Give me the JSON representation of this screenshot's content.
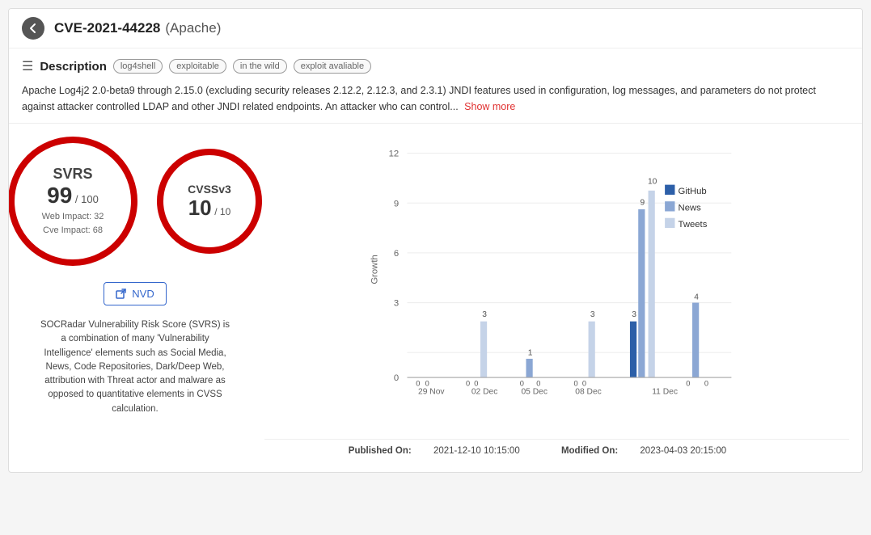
{
  "header": {
    "cve_id": "CVE-2021-44228",
    "cve_source": "(Apache)",
    "back_label": "back"
  },
  "description": {
    "section_title": "Description",
    "tags": [
      "log4shell",
      "exploitable",
      "in the wild",
      "exploit avaliable"
    ],
    "text": "Apache Log4j2 2.0-beta9 through 2.15.0 (excluding security releases 2.12.2, 2.12.3, and 2.3.1) JNDI features used in configuration, log messages, and parameters do not protect against attacker controlled LDAP and other JNDI related endpoints. An attacker who can control...",
    "show_more": "Show more"
  },
  "svrs": {
    "label": "SVRS",
    "score": "99",
    "denom": "/ 100",
    "web_impact": "Web Impact: 32",
    "cve_impact": "Cve Impact: 68"
  },
  "cvss": {
    "label": "CVSSv3",
    "score": "10",
    "denom": "/ 10"
  },
  "nvd_button": "NVD",
  "svrs_description": "SOCRadar Vulnerability Risk Score (SVRS) is a combination of many 'Vulnerability Intelligence' elements such as Social Media, News, Code Repositories, Dark/Deep Web, attribution with Threat actor and malware as opposed to quantitative elements in CVSS calculation.",
  "chart": {
    "y_label": "Growth",
    "y_max": 12,
    "legend": [
      "GitHub",
      "News",
      "Tweets"
    ],
    "x_labels": [
      "29 Nov",
      "02 Dec",
      "05 Dec",
      "08 Dec",
      "11 Dec"
    ],
    "groups": [
      {
        "label": "29 Nov",
        "github": 0,
        "news": 0,
        "tweets": 0
      },
      {
        "label": "02 Dec",
        "github": 0,
        "news": 0,
        "tweets": 3
      },
      {
        "label": "05 Dec",
        "github": 0,
        "news": 1,
        "tweets": 0
      },
      {
        "label": "08 Dec",
        "github": 0,
        "news": 0,
        "tweets": 3
      },
      {
        "label": "11 Dec",
        "github": 3,
        "news": 9,
        "tweets": 10
      },
      {
        "label": "11 Dec b",
        "github": 0,
        "news": 4,
        "tweets": 0
      }
    ]
  },
  "footer": {
    "published_label": "Published On:",
    "published_value": "2021-12-10 10:15:00",
    "modified_label": "Modified On:",
    "modified_value": "2023-04-03 20:15:00"
  }
}
